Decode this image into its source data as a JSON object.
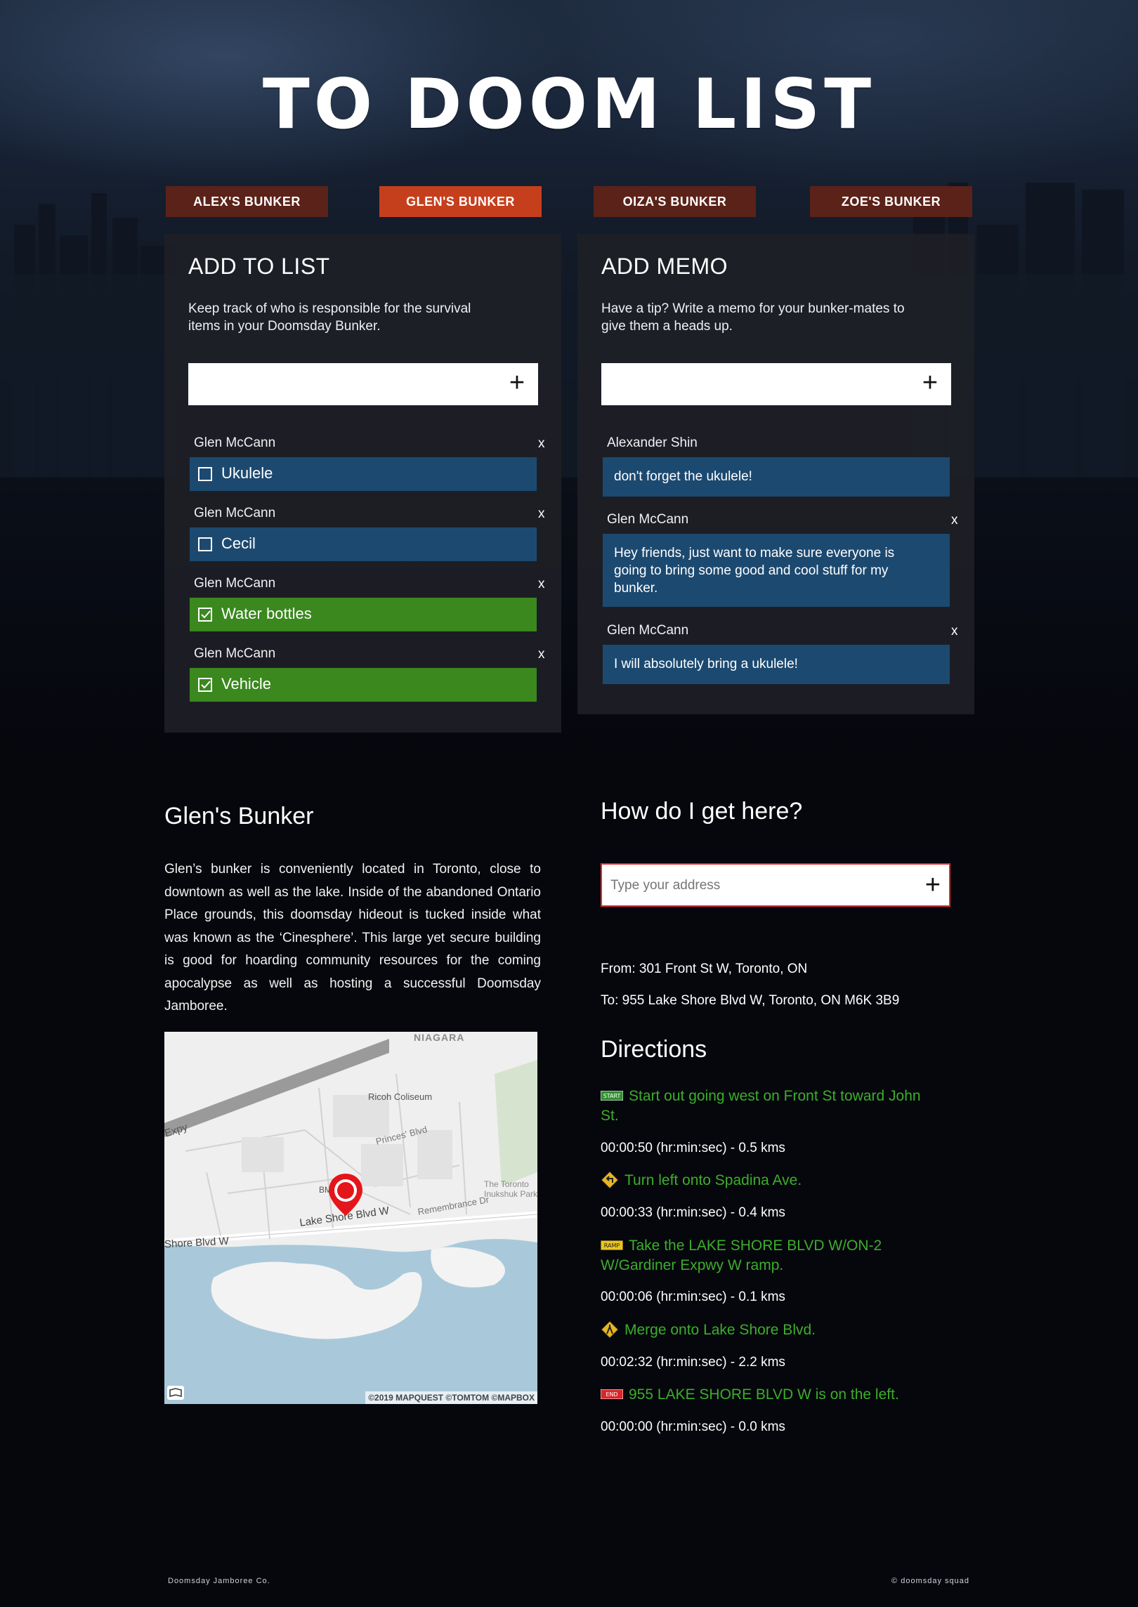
{
  "site": {
    "title": "TO DOOM LIST"
  },
  "tabs": [
    {
      "label": "ALEX'S BUNKER",
      "active": false
    },
    {
      "label": "GLEN'S BUNKER",
      "active": true
    },
    {
      "label": "OIZA'S BUNKER",
      "active": false
    },
    {
      "label": "ZOE'S BUNKER",
      "active": false
    }
  ],
  "list_panel": {
    "title": "ADD TO LIST",
    "description": "Keep track of who is responsible for the survival items in your Doomsday Bunker.",
    "input_value": "",
    "add_icon": "plus-icon",
    "items": [
      {
        "author": "Glen McCann",
        "remove": "x",
        "text": "Ukulele",
        "checked": false
      },
      {
        "author": "Glen McCann",
        "remove": "x",
        "text": "Cecil",
        "checked": false
      },
      {
        "author": "Glen McCann",
        "remove": "x",
        "text": "Water bottles",
        "checked": true
      },
      {
        "author": "Glen McCann",
        "remove": "x",
        "text": "Vehicle",
        "checked": true
      }
    ]
  },
  "memo_panel": {
    "title": "ADD MEMO",
    "description": "Have a tip? Write a memo for your bunker-mates to give them a heads up.",
    "input_value": "",
    "add_icon": "plus-icon",
    "memos": [
      {
        "author": "Alexander Shin",
        "remove": "",
        "text": "don't forget the ukulele!"
      },
      {
        "author": "Glen McCann",
        "remove": "x",
        "text": "Hey friends, just want to make sure everyone is going to bring some good and cool stuff for my bunker."
      },
      {
        "author": "Glen McCann",
        "remove": "x",
        "text": "I will absolutely bring a ukulele!"
      }
    ]
  },
  "bunker": {
    "title": "Glen's Bunker",
    "description": "Glen’s bunker is conveniently located in Toronto, close to downtown as well as the lake. Inside of the abandoned Ontario Place grounds, this doomsday hideout is tucked inside what was known as the ‘Cinesphere’. This large yet secure building is good for hoarding community resources for the coming apocalypse as well as hosting a successful Doomsday Jamboree."
  },
  "map": {
    "labels": {
      "niagara": "NIAGARA",
      "coliseum": "Ricoh Coliseum",
      "princes": "Princes' Blvd",
      "lakeshore": "Lake Shore Blvd W",
      "lakeshore_left": "Shore Blvd W",
      "remembrance": "Remembrance Dr",
      "inukshuk": "The Toronto Inukshuk Park",
      "gardiner": "Expy",
      "bm": "BM"
    },
    "attribution": "©2019 MAPQUEST ©TOMTOM ©MAPBOX",
    "pin_icon": "location-pin-icon",
    "layers_icon": "map-layers-icon",
    "colors": {
      "water": "#a9c9da",
      "land": "#efefef",
      "pin": "#e4161b"
    }
  },
  "directions_form": {
    "title": "How do I get here?",
    "placeholder": "Type your address",
    "add_icon": "plus-icon",
    "from": "From: 301 Front St W, Toronto, ON",
    "to": "To: 955 Lake Shore Blvd W, Toronto, ON M6K 3B9"
  },
  "directions": {
    "title": "Directions",
    "steps": [
      {
        "icon": "start-sign-icon",
        "badge": "START",
        "text": "Start out going west on Front St toward John St.",
        "time": "00:00:50 (hr:min:sec) - 0.5 kms"
      },
      {
        "icon": "turn-left-sign-icon",
        "badge": "",
        "text": "Turn left onto Spadina Ave.",
        "time": "00:00:33 (hr:min:sec) - 0.4 kms"
      },
      {
        "icon": "ramp-sign-icon",
        "badge": "RAMP",
        "text": "Take the LAKE SHORE BLVD W/ON-2 W/Gardiner Expwy W ramp.",
        "time": "00:00:06 (hr:min:sec) - 0.1 kms"
      },
      {
        "icon": "merge-sign-icon",
        "badge": "",
        "text": "Merge onto Lake Shore Blvd.",
        "time": "00:02:32 (hr:min:sec) - 2.2 kms"
      },
      {
        "icon": "end-sign-icon",
        "badge": "END",
        "text": "955 LAKE SHORE BLVD W is on the left.",
        "time": "00:00:00 (hr:min:sec) - 0.0 kms"
      }
    ]
  },
  "footer": {
    "left": "Doomsday Jamboree Co.",
    "right": "© doomsday squad"
  },
  "colors": {
    "tab": "#5b2219",
    "tab_active": "#c63f1c",
    "item_open": "#1c4970",
    "item_done": "#3a881e",
    "direction_text": "#3cae2a",
    "address_border": "#e02d2d"
  }
}
